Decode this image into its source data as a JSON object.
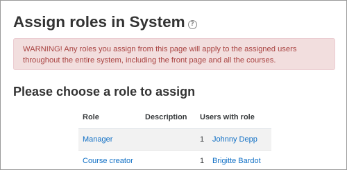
{
  "page": {
    "title": "Assign roles in System",
    "help_icon": "question-circle-icon"
  },
  "alert": {
    "text": "WARNING! Any roles you assign from this page will apply to the assigned users throughout the entire system, including the front page and all the courses."
  },
  "section": {
    "title": "Please choose a role to assign"
  },
  "table": {
    "headers": {
      "role": "Role",
      "description": "Description",
      "users": "Users with role"
    },
    "rows": [
      {
        "role": "Manager",
        "description": "",
        "count": "1",
        "user": "Johnny Depp"
      },
      {
        "role": "Course creator",
        "description": "",
        "count": "1",
        "user": "Brigitte Bardot"
      }
    ]
  },
  "colors": {
    "alert_bg": "#f2dede",
    "alert_text": "#a94442",
    "link": "#0f6fc5"
  }
}
